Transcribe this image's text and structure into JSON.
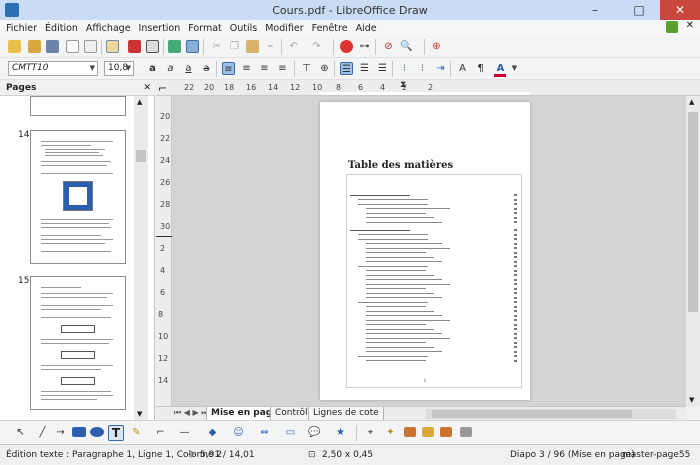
{
  "window": {
    "title": "Cours.pdf - LibreOffice Draw"
  },
  "menu": [
    "Fichier",
    "Édition",
    "Affichage",
    "Insertion",
    "Format",
    "Outils",
    "Modifier",
    "Fenêtre",
    "Aide"
  ],
  "format_toolbar": {
    "font_name": "CMTT10",
    "font_size": "10,8"
  },
  "pages_panel": {
    "title": "Pages",
    "pages": [
      {
        "number": "14"
      },
      {
        "number": "15"
      }
    ]
  },
  "ruler": {
    "h_labels": [
      "22",
      "20",
      "18",
      "16",
      "14",
      "12",
      "10",
      "8",
      "6",
      "4",
      "2",
      "2"
    ],
    "v_labels": [
      "20",
      "22",
      "24",
      "26",
      "28",
      "30",
      "2",
      "4",
      "6",
      "8",
      "10",
      "12",
      "14"
    ]
  },
  "document": {
    "toc_title": "Table des matières",
    "footer_page_number": "ii"
  },
  "tabs": [
    "Mise en page",
    "Contrôles",
    "Lignes de cote"
  ],
  "status": {
    "edit_text": "Édition texte : Paragraphe 1, Ligne 1, Colonne 2",
    "position": "5,91 / 14,01",
    "size": "2,50 x 0,45",
    "slide": "Diapo 3 / 96 (Mise en page)",
    "master": "master-page55"
  },
  "colors": {
    "titlebar": "#c9dcf3",
    "accent_blue": "#2d5fb0",
    "close_red": "#c9473d"
  }
}
